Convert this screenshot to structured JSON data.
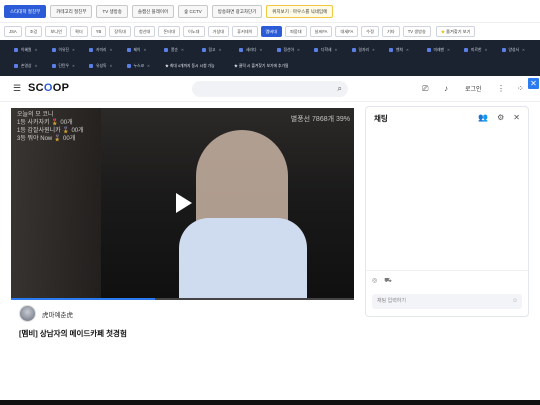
{
  "topbar": {
    "buttons": [
      {
        "label": "스타대학 절친부",
        "style": "blue"
      },
      {
        "label": "카테고리 절친부",
        "style": "plain"
      },
      {
        "label": "TV 생방송",
        "style": "plain"
      },
      {
        "label": "솔캠신 플레이어",
        "style": "plain"
      },
      {
        "label": "숲 CCTV",
        "style": "plain"
      },
      {
        "label": "방송화면 광고차단기",
        "style": "plain"
      },
      {
        "label": "위치보기 · 마우스를 닉네임에",
        "style": "yellow"
      }
    ]
  },
  "filters": {
    "chips": [
      "JSA",
      "조깅",
      "보니언",
      "퀵더",
      "YB",
      "장독대",
      "청선대",
      "돈터대",
      "이노대",
      "거성대",
      "휴커데이",
      "멤버대",
      "파뭄대",
      "날씨FA",
      "대세FA",
      "수정",
      "기타",
      "TV 생방송"
    ],
    "active": "멤버대",
    "favorites_label": "즐겨찾기 보기",
    "favorites_icon": "star-icon"
  },
  "bookmarks": {
    "row1": [
      "이혜원",
      "이유진",
      "카미리",
      "제이",
      "쫑순",
      "링고",
      "세라다",
      "정선아",
      "다학세",
      "일자리",
      "벤쳐",
      "미래맨",
      "미르한",
      "양성서"
    ],
    "row2": [
      "손영상",
      "단탄우",
      "유성독",
      "누스코"
    ],
    "notes": [
      "★ 최대 4개까지 동시 시청 가능",
      "★ 클릭 시 즐겨찾기 보기에 추가됨"
    ]
  },
  "header": {
    "logo_prefix": "SC",
    "logo_mid": "O",
    "logo_suffix": "OP",
    "login_label": "로그인"
  },
  "video": {
    "overlay_lines": [
      "오늘의 모 코니",
      "1등 사카자키 🎖️ 00개",
      "1등 감잘사원니카 🎖️ 00개",
      "3등 뭐야 Now 🎖️ 00개"
    ],
    "overlay_right": "별풍선 7868개 39%",
    "progress_fraction": 0.42
  },
  "channel": {
    "name": "虎마예춘虎",
    "title": "[멤비] 상남자의 메이드카페 첫경험"
  },
  "chat": {
    "title": "채팅",
    "input_placeholder": "채팅 입력하기"
  },
  "colors": {
    "accent": "#2b5bd7",
    "bookmark_bg": "#1b2330",
    "video_bg": "#151515"
  }
}
